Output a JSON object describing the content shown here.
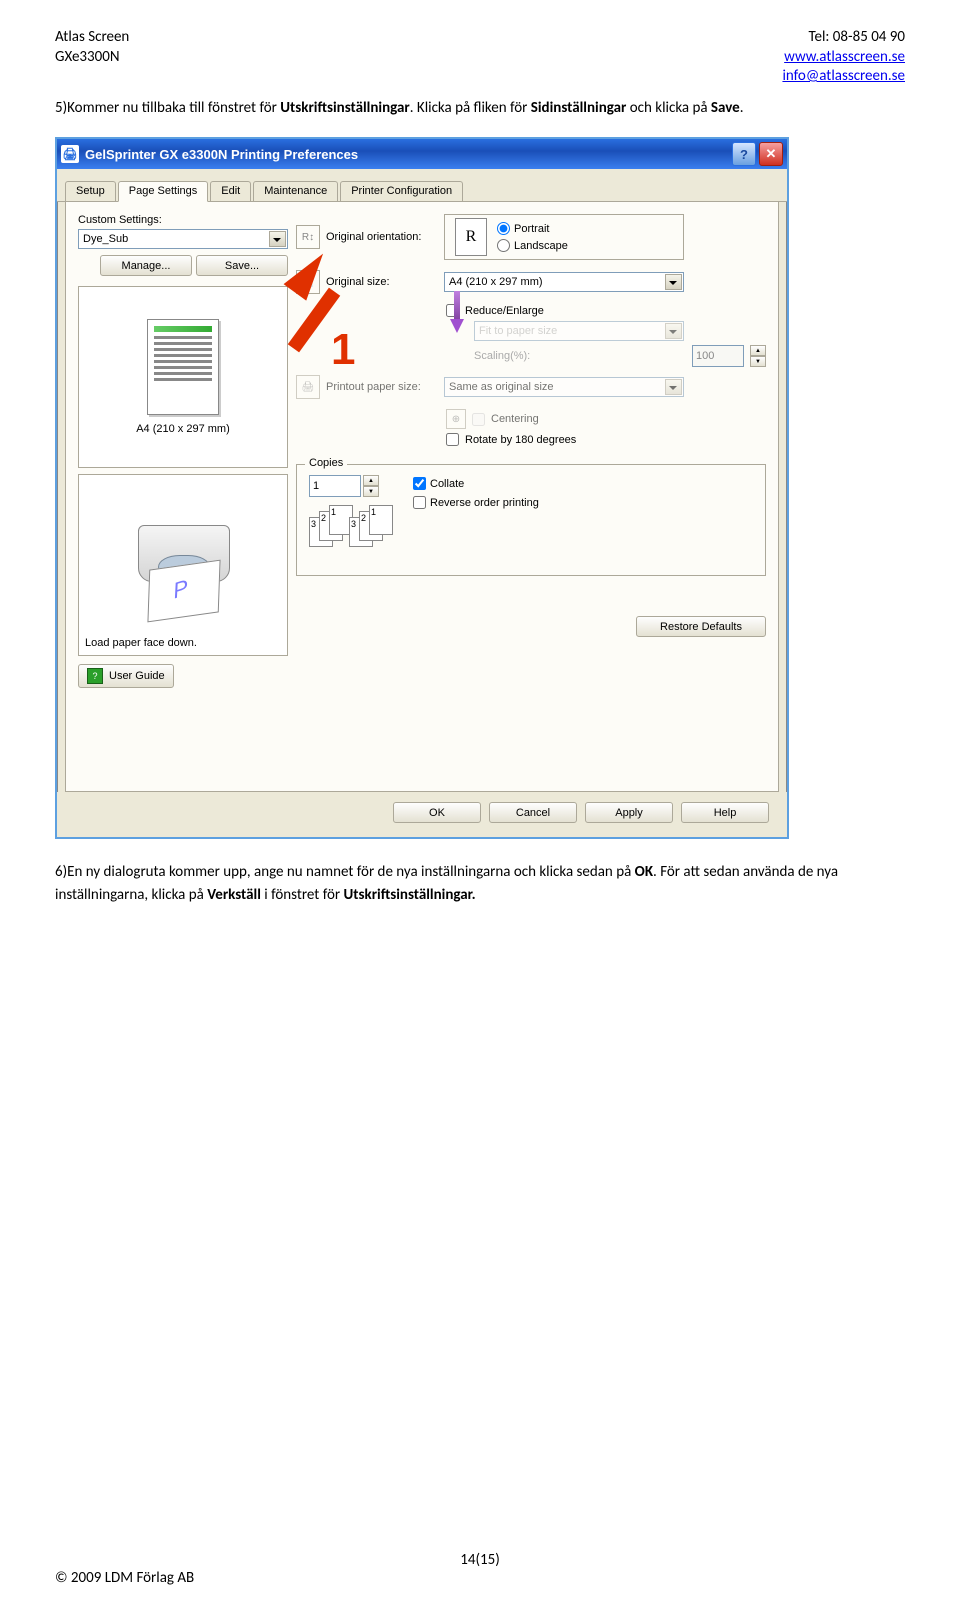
{
  "doc": {
    "header_left_1": "Atlas Screen",
    "header_left_2": "GXe3300N",
    "header_right_1": "Tel: 08-85 04 90",
    "header_right_2": "www.atlasscreen.se",
    "header_right_3": "info@atlasscreen.se",
    "para1_a": "5)Kommer nu tillbaka till fönstret för ",
    "para1_b": "Utskriftsinställningar",
    "para1_c": ". Klicka på fliken för ",
    "para1_d": "Sidinställningar",
    "para1_e": " och klicka på ",
    "para1_f": "Save",
    "para1_g": ".",
    "para2_a": "6)En ny dialogruta kommer upp, ange nu namnet för de nya inställningarna och klicka sedan på ",
    "para2_b": "OK",
    "para2_c": ". För att sedan använda de nya inställningarna, klicka på ",
    "para2_d": "Verkställ",
    "para2_e": " i fönstret för ",
    "para2_f": "Utskriftsinställningar.",
    "page_num": "14(15)",
    "copyright": "© 2009 LDM Förlag AB"
  },
  "dlg": {
    "title": "GelSprinter GX e3300N Printing Preferences",
    "tabs": [
      "Setup",
      "Page Settings",
      "Edit",
      "Maintenance",
      "Printer Configuration"
    ],
    "custom_settings_label": "Custom Settings:",
    "custom_settings_value": "Dye_Sub",
    "manage_btn": "Manage...",
    "save_btn": "Save...",
    "preview_paper": "A4 (210 x 297 mm)",
    "load_paper": "Load paper face down.",
    "user_guide": "User Guide",
    "orig_orient": "Original orientation:",
    "portrait": "Portrait",
    "landscape": "Landscape",
    "orig_size": "Original size:",
    "orig_size_val": "A4 (210 x 297 mm)",
    "reduce": "Reduce/Enlarge",
    "fit": "Fit to paper size",
    "scaling": "Scaling(%):",
    "scaling_val": "100",
    "printout_size": "Printout paper size:",
    "printout_size_val": "Same as original size",
    "centering": "Centering",
    "rotate": "Rotate by 180 degrees",
    "copies_legend": "Copies",
    "copies_val": "1",
    "collate": "Collate",
    "reverse": "Reverse order printing",
    "restore": "Restore Defaults",
    "ok": "OK",
    "cancel": "Cancel",
    "apply": "Apply",
    "help": "Help",
    "orient_thumb": "R",
    "anno1": "1"
  }
}
